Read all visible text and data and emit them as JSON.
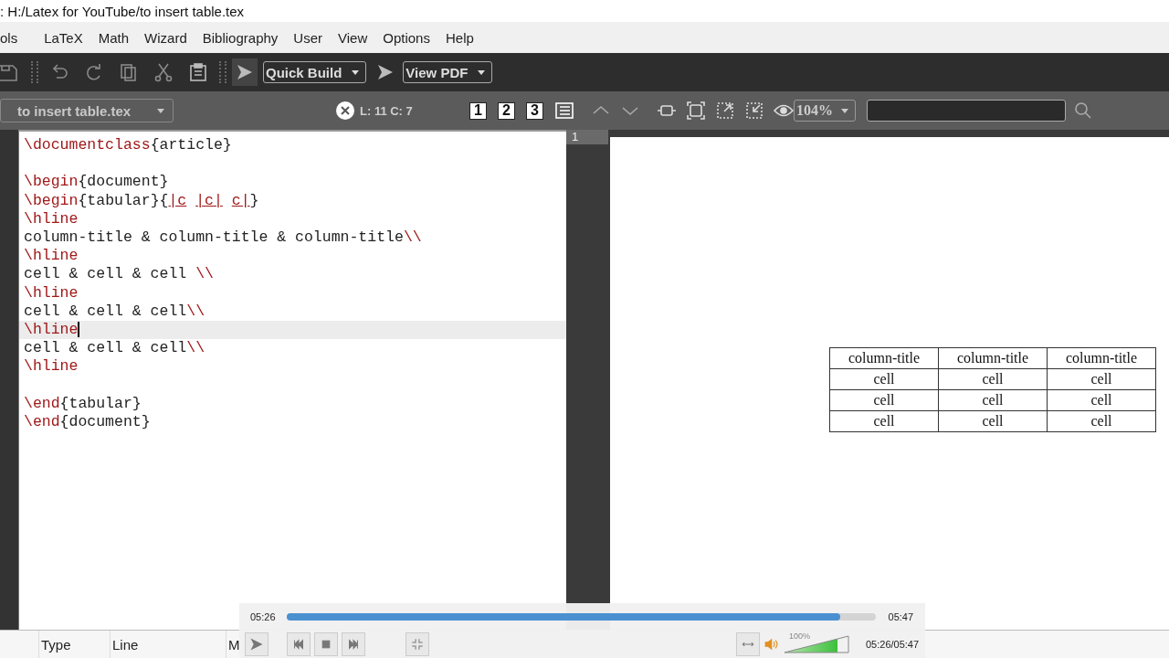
{
  "window": {
    "title": ": H:/Latex for YouTube/to insert table.tex"
  },
  "menu": [
    "ols",
    "LaTeX",
    "Math",
    "Wizard",
    "Bibliography",
    "User",
    "View",
    "Options",
    "Help"
  ],
  "toolbar": {
    "run_hovered": true,
    "build": "Quick Build",
    "view": "View PDF"
  },
  "editor_bar": {
    "file": "to insert table.tex",
    "cursor": "L: 11 C: 7",
    "bookmarks": [
      "1",
      "2",
      "3"
    ],
    "zoom": "104%"
  },
  "editor": {
    "lines": [
      {
        "kind": "code",
        "current": false,
        "segments": [
          {
            "text": "\\documentclass",
            "kind": "cmd"
          },
          {
            "text": "{article}",
            "kind": "text"
          }
        ]
      },
      {
        "kind": "blank",
        "current": false
      },
      {
        "kind": "code",
        "current": false,
        "segments": [
          {
            "text": "\\begin",
            "kind": "cmd"
          },
          {
            "text": "{document}",
            "kind": "text"
          }
        ]
      },
      {
        "kind": "code",
        "current": false,
        "segments": [
          {
            "text": "\\begin",
            "kind": "cmd"
          },
          {
            "text": "{tabular}{",
            "kind": "text"
          },
          {
            "words": [
              "|c",
              "|c|",
              "c|"
            ],
            "kind": "flagged"
          },
          {
            "text": "}",
            "kind": "text"
          }
        ]
      },
      {
        "kind": "code",
        "current": false,
        "segments": [
          {
            "text": "\\hline",
            "kind": "cmd"
          }
        ]
      },
      {
        "kind": "code",
        "current": false,
        "segments": [
          {
            "text": "column-title & column-title & column-title",
            "kind": "text"
          },
          {
            "text": "\\\\",
            "kind": "cmd"
          }
        ]
      },
      {
        "kind": "code",
        "current": false,
        "segments": [
          {
            "text": "\\hline",
            "kind": "cmd"
          }
        ]
      },
      {
        "kind": "code",
        "current": false,
        "segments": [
          {
            "text": "cell & cell & cell ",
            "kind": "text"
          },
          {
            "text": "\\\\",
            "kind": "cmd"
          }
        ]
      },
      {
        "kind": "code",
        "current": false,
        "segments": [
          {
            "text": "\\hline",
            "kind": "cmd"
          }
        ]
      },
      {
        "kind": "code",
        "current": false,
        "segments": [
          {
            "text": "cell & cell & cell",
            "kind": "text"
          },
          {
            "text": "\\\\",
            "kind": "cmd"
          }
        ]
      },
      {
        "kind": "code",
        "current": true,
        "segments": [
          {
            "text": "\\hline",
            "kind": "cmd"
          }
        ]
      },
      {
        "kind": "code",
        "current": false,
        "segments": [
          {
            "text": "cell & cell & cell",
            "kind": "text"
          },
          {
            "text": "\\\\",
            "kind": "cmd"
          }
        ]
      },
      {
        "kind": "code",
        "current": false,
        "segments": [
          {
            "text": "\\hline",
            "kind": "cmd"
          }
        ]
      },
      {
        "kind": "blank",
        "current": false
      },
      {
        "kind": "code",
        "current": false,
        "segments": [
          {
            "text": "\\end",
            "kind": "cmd"
          },
          {
            "text": "{tabular}",
            "kind": "text"
          }
        ]
      },
      {
        "kind": "code",
        "current": false,
        "segments": [
          {
            "text": "\\end",
            "kind": "cmd"
          },
          {
            "text": "{document}",
            "kind": "text"
          }
        ]
      }
    ]
  },
  "pdf": {
    "page": "1",
    "table": {
      "header": [
        "column-title",
        "column-title",
        "column-title"
      ],
      "rows": [
        [
          "cell",
          "cell",
          "cell"
        ],
        [
          "cell",
          "cell",
          "cell"
        ],
        [
          "cell",
          "cell",
          "cell"
        ]
      ]
    }
  },
  "messages": {
    "columns": [
      "Type",
      "Line",
      "M"
    ]
  },
  "player": {
    "elapsed": "05:26",
    "total": "05:47",
    "level": 0.94,
    "volume": {
      "label": "100%",
      "level": 0.82
    },
    "time": "05:26/05:47"
  }
}
